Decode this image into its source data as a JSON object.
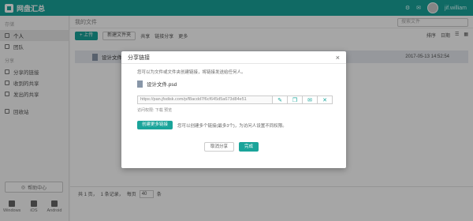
{
  "app": {
    "title": "网盘汇总"
  },
  "topbar": {
    "username": "jif.william"
  },
  "sidebar": {
    "section_files": "存储",
    "items": [
      {
        "label": "个人"
      },
      {
        "label": "团队"
      }
    ],
    "section_share": "分享",
    "share_items": [
      {
        "label": "分享的链接"
      },
      {
        "label": "收到的共享"
      },
      {
        "label": "发出的共享"
      }
    ],
    "trash_label": "回收站",
    "help_label": "帮助中心",
    "platforms": [
      {
        "label": "Windows"
      },
      {
        "label": "iOS"
      },
      {
        "label": "Android"
      }
    ]
  },
  "main": {
    "breadcrumb": "我的文件",
    "search_placeholder": "搜索文件",
    "toolbar": {
      "upload": "+ 上传",
      "new_folder": "新建文件夹",
      "share": "共享",
      "link_share": "链接分享",
      "more": "更多"
    },
    "sort": {
      "by": "排序",
      "field": "日期"
    },
    "files": [
      {
        "name": "设计文件.psd",
        "date": "2017-05-13 14:52:54"
      }
    ],
    "footer": {
      "prefix": "共 1 页，",
      "count": "1 条记录，",
      "per_page_label": "每页",
      "per_page": "40",
      "suffix": "条"
    }
  },
  "modal": {
    "title": "分享链接",
    "description": "您可以为文件或文件夹创建链接，将链接发送给任何人。",
    "file_name": "设计文件.psd",
    "link": "https://pan.jfsdisk.com/p/f8acdd7f6cf645d5a673d84e51",
    "permission": "访问权限: 下载 预览",
    "create_button": "创建更多链接",
    "create_note": "您可以创建多个链接(最多3个)，为访问人设置不同权限。",
    "cancel_button": "取消分享",
    "done_button": "完成",
    "icons": [
      "edit-icon",
      "copy-icon",
      "email-icon",
      "delete-icon"
    ]
  },
  "colors": {
    "accent": "#1aa49a"
  }
}
